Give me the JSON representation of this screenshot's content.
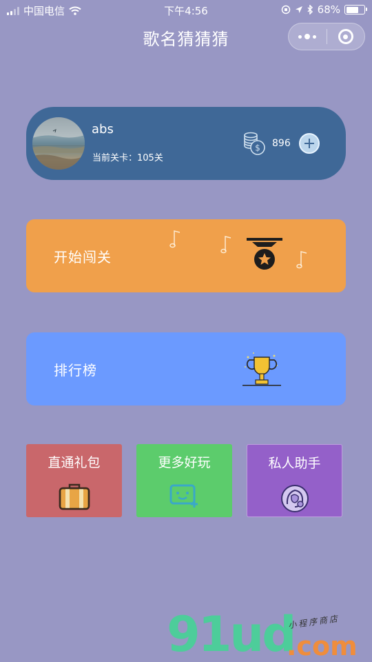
{
  "status_bar": {
    "carrier": "中国电信",
    "time": "下午4:56",
    "battery_percent": "68%",
    "battery_level": 0.68
  },
  "nav": {
    "title": "歌名猜猜猜",
    "menu_icon": "more-dots-icon",
    "close_icon": "target-circle-icon"
  },
  "user": {
    "name": "abs",
    "level_text": "当前关卡：105关",
    "coins": "896",
    "coin_icon": "coin-stack-icon",
    "add_icon": "plus-circle-icon"
  },
  "actions": {
    "start": {
      "label": "开始闯关",
      "icon": "medal-icon",
      "color": "#f0a04b"
    },
    "rank": {
      "label": "排行榜",
      "icon": "trophy-icon",
      "color": "#6b9aff"
    }
  },
  "tiles": [
    {
      "label": "直通礼包",
      "icon": "suitcase-icon",
      "color": "#c9676b"
    },
    {
      "label": "更多好玩",
      "icon": "game-face-icon",
      "color": "#5ccc6c"
    },
    {
      "label": "私人助手",
      "icon": "assistant-icon",
      "color": "#9460c9"
    }
  ],
  "watermark": {
    "brand": "91ud",
    "domain": ".com",
    "tagline": "小程序商店"
  },
  "colors": {
    "background": "#9897c4",
    "user_card": "#3f6897"
  }
}
